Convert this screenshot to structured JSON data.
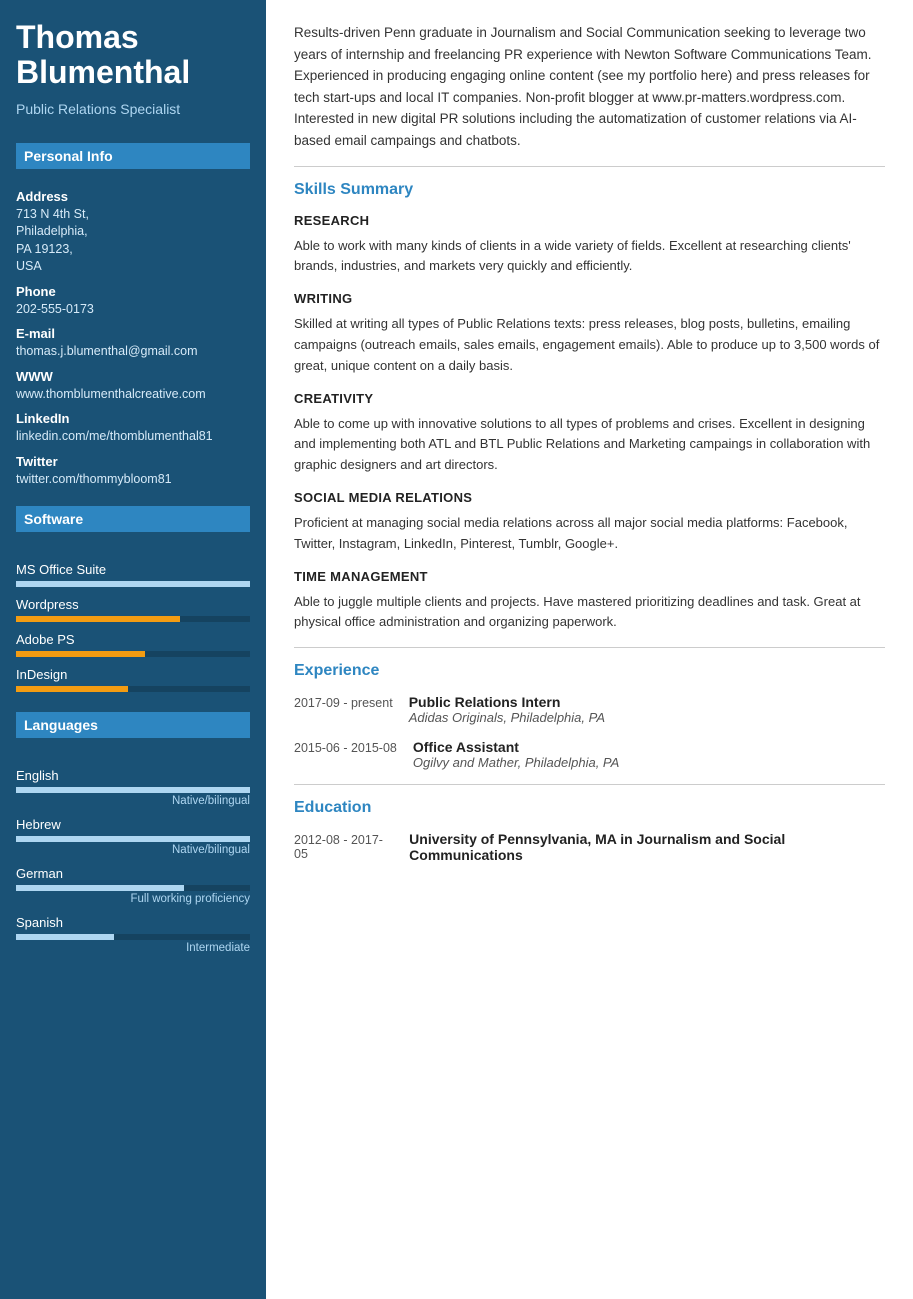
{
  "sidebar": {
    "name": "Thomas Blumenthal",
    "title": "Public Relations Specialist",
    "sections": {
      "personal_info": "Personal Info",
      "software": "Software",
      "languages": "Languages"
    },
    "personal": {
      "address_label": "Address",
      "address_value": "713 N 4th St,\nPhiladelphia,\nPA 19123,\nUSA",
      "phone_label": "Phone",
      "phone_value": "202-555-0173",
      "email_label": "E-mail",
      "email_value": "thomas.j.blumenthal@gmail.com",
      "www_label": "WWW",
      "www_value": "www.thomblumenthalcreative.com",
      "linkedin_label": "LinkedIn",
      "linkedin_value": "linkedin.com/me/thomblumenthal81",
      "twitter_label": "Twitter",
      "twitter_value": "twitter.com/thommybloom81"
    },
    "software": [
      {
        "name": "MS Office Suite",
        "fill": 100,
        "type": "full"
      },
      {
        "name": "Wordpress",
        "fill": 70,
        "type": "partial"
      },
      {
        "name": "Adobe PS",
        "fill": 55,
        "type": "partial"
      },
      {
        "name": "InDesign",
        "fill": 48,
        "type": "partial"
      }
    ],
    "languages": [
      {
        "name": "English",
        "fill": 100,
        "level": "Native/bilingual"
      },
      {
        "name": "Hebrew",
        "fill": 100,
        "level": "Native/bilingual"
      },
      {
        "name": "German",
        "fill": 72,
        "level": "Full working proficiency"
      },
      {
        "name": "Spanish",
        "fill": 42,
        "level": "Intermediate"
      }
    ]
  },
  "main": {
    "summary": "Results-driven Penn graduate in Journalism and Social Communication seeking to leverage two years of internship and freelancing PR experience with Newton Software Communications Team. Experienced in producing engaging online content (see my portfolio here) and press releases for tech start-ups and local IT companies. Non-profit blogger at www.pr-matters.wordpress.com. Interested in new digital PR solutions including the automatization of customer relations via AI-based email campaings and chatbots.",
    "skills_summary_title": "Skills Summary",
    "skills": [
      {
        "title": "RESEARCH",
        "description": "Able to work with many kinds of clients in a wide variety of fields. Excellent at researching clients' brands, industries, and markets very quickly and efficiently."
      },
      {
        "title": "WRITING",
        "description": "Skilled at writing all types of Public Relations texts: press releases, blog posts, bulletins, emailing campaigns (outreach emails, sales emails, engagement emails). Able to produce up to 3,500 words of great, unique content on a daily basis."
      },
      {
        "title": "CREATIVITY",
        "description": "Able to come up with innovative solutions to all types of problems and crises. Excellent in designing and implementing both ATL and BTL Public Relations and Marketing campaings in collaboration with graphic designers and art directors."
      },
      {
        "title": "SOCIAL MEDIA RELATIONS",
        "description": "Proficient at managing social media relations across all major social media platforms: Facebook, Twitter, Instagram, LinkedIn, Pinterest, Tumblr, Google+."
      },
      {
        "title": "TIME MANAGEMENT",
        "description": "Able to juggle multiple clients and projects. Have mastered prioritizing deadlines and task. Great at physical office administration and organizing paperwork."
      }
    ],
    "experience_title": "Experience",
    "experience": [
      {
        "date": "2017-09 - present",
        "title": "Public Relations Intern",
        "company": "Adidas Originals, Philadelphia, PA"
      },
      {
        "date": "2015-06 - 2015-08",
        "title": "Office Assistant",
        "company": "Ogilvy and Mather, Philadelphia, PA"
      }
    ],
    "education_title": "Education",
    "education": [
      {
        "date": "2012-08 - 2017-05",
        "degree": "University of Pennsylvania, MA in Journalism and Social Communications"
      }
    ]
  }
}
